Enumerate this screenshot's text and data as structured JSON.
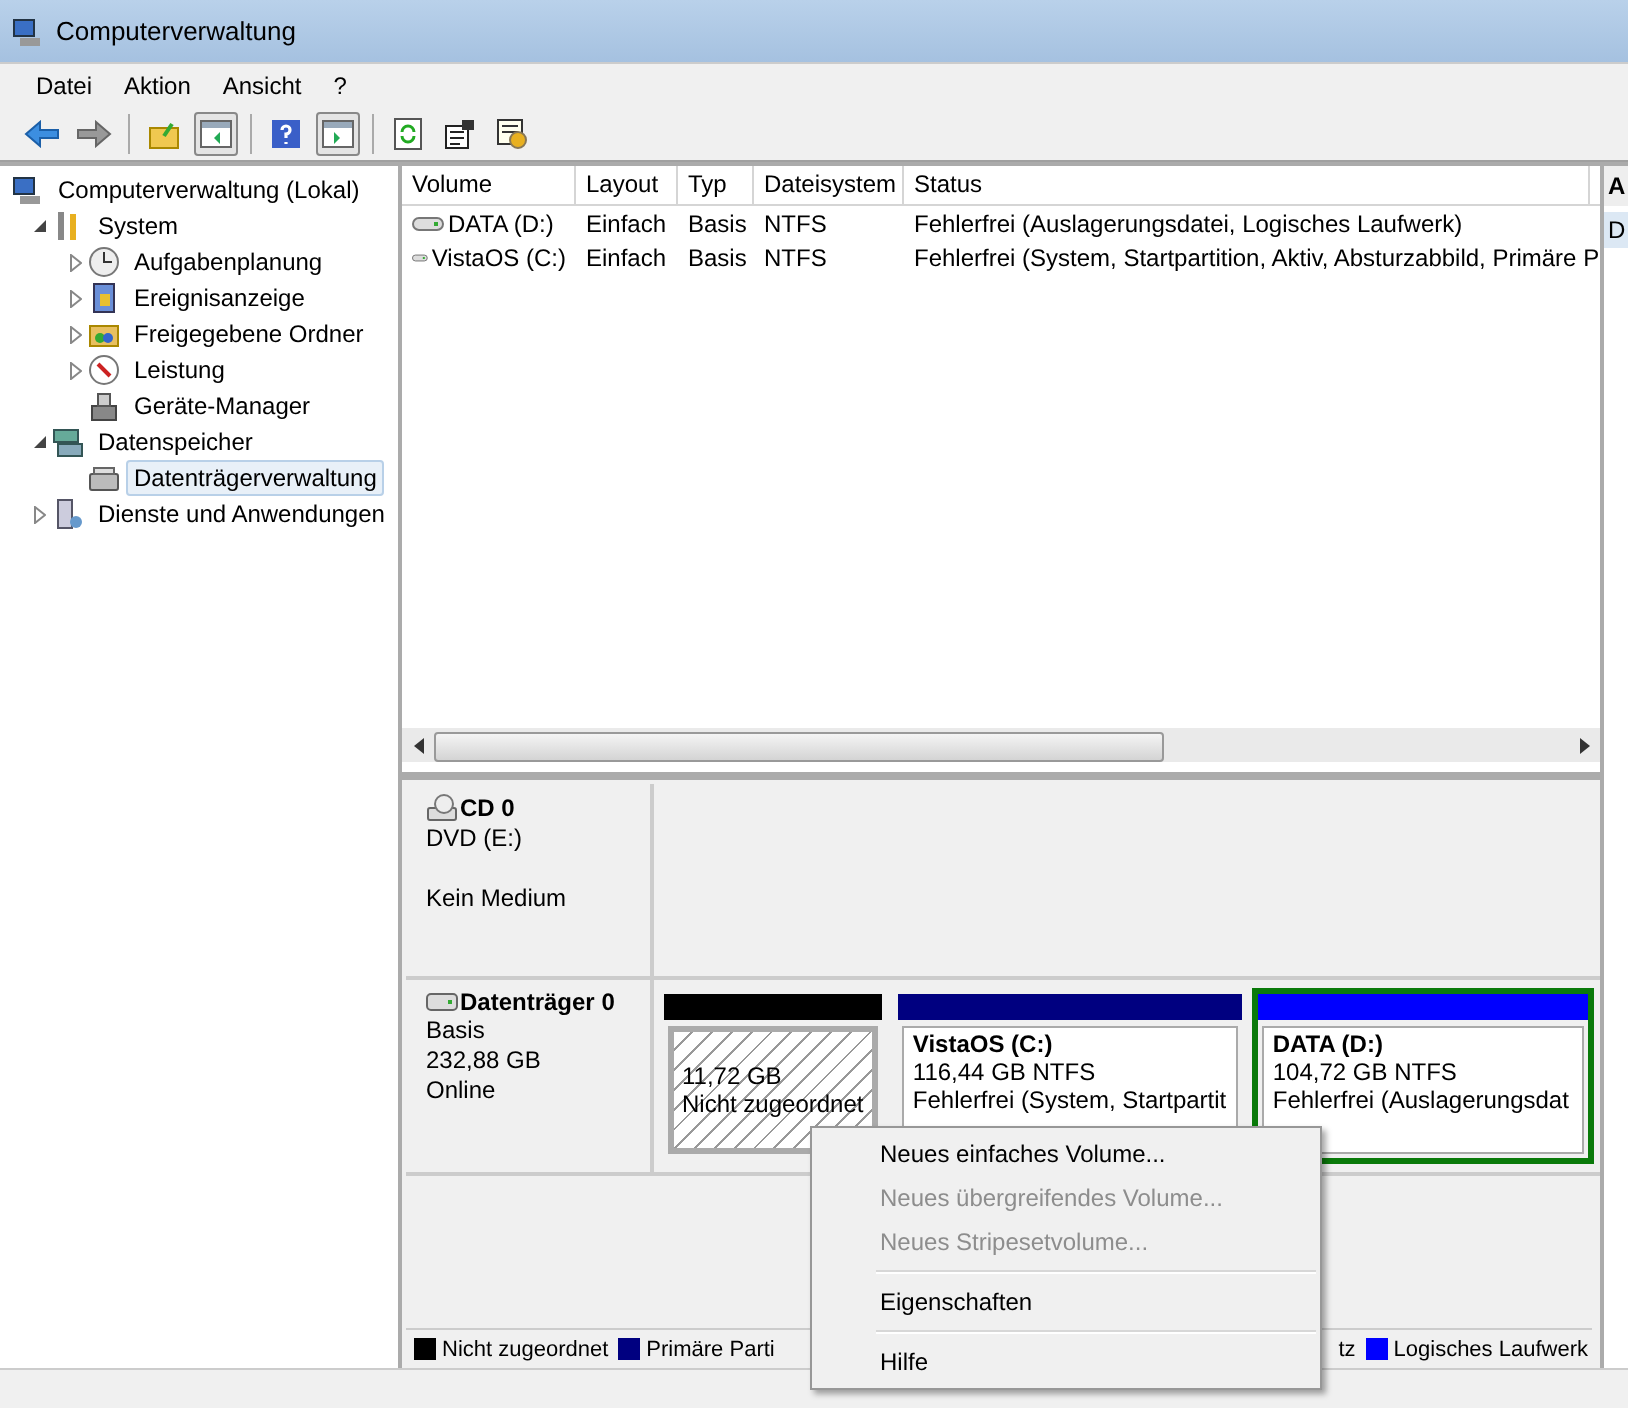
{
  "window": {
    "title": "Computerverwaltung"
  },
  "menu_bar": [
    "Datei",
    "Aktion",
    "Ansicht",
    "?"
  ],
  "tree": [
    {
      "label": "Computerverwaltung (Lokal)",
      "selected": false,
      "children": [
        {
          "label": "System",
          "expanded": true,
          "selected": false,
          "children": [
            {
              "label": "Aufgabenplanung",
              "expanded": false,
              "selected": false
            },
            {
              "label": "Ereignisanzeige",
              "expanded": false,
              "selected": false
            },
            {
              "label": "Freigegebene Ordner",
              "expanded": false,
              "selected": false
            },
            {
              "label": "Leistung",
              "expanded": false,
              "selected": false
            },
            {
              "label": "Geräte-Manager",
              "selected": false
            }
          ]
        },
        {
          "label": "Datenspeicher",
          "expanded": true,
          "selected": false,
          "children": [
            {
              "label": "Datenträgerverwaltung",
              "selected": true
            }
          ]
        },
        {
          "label": "Dienste und Anwendungen",
          "expanded": false,
          "selected": false
        }
      ]
    }
  ],
  "table": {
    "columns": [
      "Volume",
      "Layout",
      "Typ",
      "Dateisystem",
      "Status"
    ],
    "rows": [
      [
        "DATA (D:)",
        "Einfach",
        "Basis",
        "NTFS",
        "Fehlerfrei (Auslagerungsdatei, Logisches Laufwerk)"
      ],
      [
        "VistaOS (C:)",
        "Einfach",
        "Basis",
        "NTFS",
        "Fehlerfrei (System, Startpartition, Aktiv, Absturzabbild, Primäre P"
      ]
    ]
  },
  "disks": [
    {
      "kind": "cd",
      "name": "CD 0",
      "lines": [
        "DVD (E:)",
        "Kein Medium"
      ]
    },
    {
      "kind": "disk",
      "name": "Datenträger 0",
      "lines": [
        "Basis",
        "232,88 GB",
        "Online"
      ],
      "partitions": [
        {
          "kind": "unallocated",
          "color": "#000000",
          "size": "11,72 GB",
          "status": "Nicht zugeordnet",
          "selected": false
        },
        {
          "kind": "volume",
          "color": "#000080",
          "name": "VistaOS  (C:)",
          "size": "116,44 GB NTFS",
          "status": "Fehlerfrei (System, Startpartit",
          "selected": false
        },
        {
          "kind": "volume",
          "color": "#0000ff",
          "name": "DATA  (D:)",
          "size": "104,72 GB NTFS",
          "status": "Fehlerfrei (Auslagerungsdat",
          "selected": true
        }
      ]
    }
  ],
  "legend": [
    {
      "label": "Nicht zugeordnet",
      "color": "#000000"
    },
    {
      "label": "Primäre Parti",
      "color": "#000080"
    },
    {
      "label": "tz"
    },
    {
      "label": "Logisches Laufwerk",
      "color": "#0000ff"
    }
  ],
  "actions_pane": {
    "header": "A",
    "item": "D"
  },
  "context_menu": [
    {
      "kind": "item",
      "label": "Neues einfaches Volume...",
      "disabled": false
    },
    {
      "kind": "item",
      "label": "Neues übergreifendes Volume...",
      "disabled": true
    },
    {
      "kind": "item",
      "label": "Neues Stripesetvolume...",
      "disabled": true
    },
    {
      "kind": "separator"
    },
    {
      "kind": "item",
      "label": "Eigenschaften",
      "disabled": false
    },
    {
      "kind": "separator"
    },
    {
      "kind": "item",
      "label": "Hilfe",
      "disabled": false
    }
  ]
}
